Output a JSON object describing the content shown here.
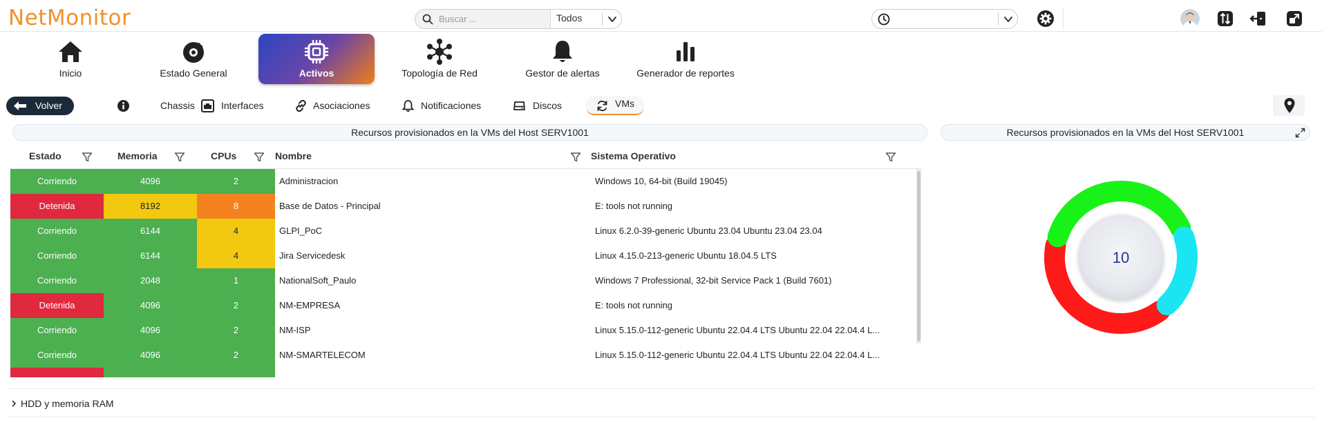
{
  "app": {
    "logo": "NetMonitor"
  },
  "header": {
    "search": {
      "placeholder": "Buscar ...",
      "value": ""
    },
    "scope": {
      "selected": "Todos"
    },
    "time_range": {
      "selected": ""
    }
  },
  "nav": [
    {
      "label": "Inicio",
      "icon": "home-icon"
    },
    {
      "label": "Estado General",
      "icon": "dashboard-gauge-icon"
    },
    {
      "label": "Activos",
      "icon": "chip-icon",
      "active": true
    },
    {
      "label": "Topología de Red",
      "icon": "network-topology-icon"
    },
    {
      "label": "Gestor de alertas",
      "icon": "bell-icon"
    },
    {
      "label": "Generador de reportes",
      "icon": "bar-chart-icon"
    }
  ],
  "subnav": {
    "back": "Volver",
    "tabs": [
      {
        "label": "Chassis",
        "icon": "info-icon"
      },
      {
        "label": "Interfaces",
        "icon": "interfaces-icon"
      },
      {
        "label": "Asociaciones",
        "icon": "link-icon"
      },
      {
        "label": "Notificaciones",
        "icon": "bell-icon"
      },
      {
        "label": "Discos",
        "icon": "disk-icon"
      },
      {
        "label": "VMs",
        "icon": "refresh-icon",
        "active": true
      }
    ]
  },
  "vm_table": {
    "title": "Recursos provisionados en la VMs del Host SERV1001",
    "columns": [
      "Estado",
      "Memoria",
      "CPUs",
      "Nombre",
      "Sistema Operativo"
    ],
    "rows": [
      {
        "estado": "Corriendo",
        "memoria": "4096",
        "cpus": "2",
        "nombre": "Administracion",
        "so": "Windows 10, 64-bit (Build 19045)"
      },
      {
        "estado": "Detenida",
        "memoria": "8192",
        "cpus": "8",
        "nombre": "Base de Datos - Principal",
        "so": "E: tools not running"
      },
      {
        "estado": "Corriendo",
        "memoria": "6144",
        "cpus": "4",
        "nombre": "GLPI_PoC",
        "so": "Linux 6.2.0-39-generic Ubuntu 23.04 Ubuntu 23.04 23.04"
      },
      {
        "estado": "Corriendo",
        "memoria": "6144",
        "cpus": "4",
        "nombre": "Jira Servicedesk",
        "so": "Linux 4.15.0-213-generic Ubuntu 18.04.5 LTS"
      },
      {
        "estado": "Corriendo",
        "memoria": "2048",
        "cpus": "1",
        "nombre": "NationalSoft_Paulo",
        "so": "Windows 7 Professional, 32-bit Service Pack 1 (Build 7601)"
      },
      {
        "estado": "Detenida",
        "memoria": "4096",
        "cpus": "2",
        "nombre": "NM-EMPRESA",
        "so": "E: tools not running"
      },
      {
        "estado": "Corriendo",
        "memoria": "4096",
        "cpus": "2",
        "nombre": "NM-ISP",
        "so": "Linux 5.15.0-112-generic Ubuntu 22.04.4 LTS Ubuntu 22.04 22.04.4 L..."
      },
      {
        "estado": "Corriendo",
        "memoria": "4096",
        "cpus": "2",
        "nombre": "NM-SMARTELECOM",
        "so": "Linux 5.15.0-112-generic Ubuntu 22.04.4 LTS Ubuntu 22.04 22.04.4 L..."
      }
    ],
    "colors": {
      "running": "#4caf50",
      "stopped": "#e0283f",
      "warning": "#f2c811",
      "critical": "#f58220"
    }
  },
  "vm_chart": {
    "title": "Recursos provisionados en la VMs del Host SERV1001",
    "total": "10"
  },
  "chart_data": {
    "type": "pie",
    "title": "Recursos provisionados en la VMs del Host SERV1001",
    "center_label": "10",
    "slices": [
      {
        "value": 4,
        "color": "#ff1a1a"
      },
      {
        "value": 4,
        "color": "#19f219"
      },
      {
        "value": 2,
        "color": "#19e6f2"
      }
    ]
  },
  "accordion": {
    "label": "HDD y memoria RAM"
  }
}
